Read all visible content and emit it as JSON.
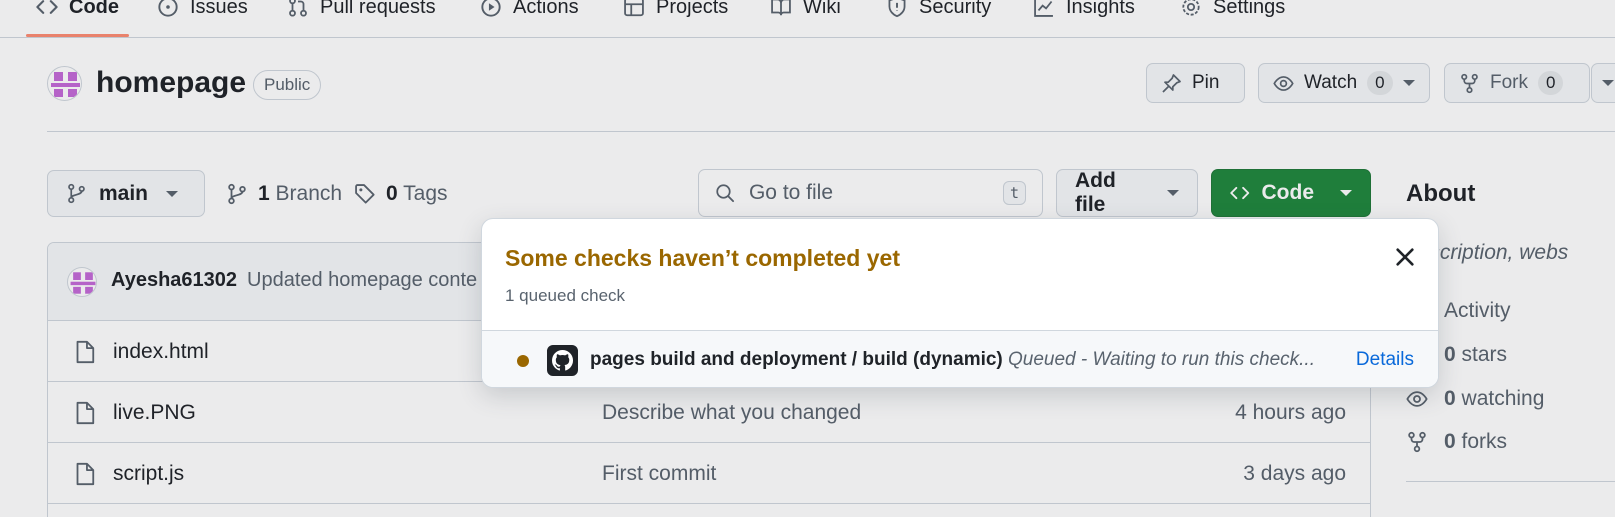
{
  "tabs": [
    {
      "label": "Code",
      "icon": "code-icon",
      "active": true
    },
    {
      "label": "Issues",
      "icon": "issue-opened-icon"
    },
    {
      "label": "Pull requests",
      "icon": "git-pull-request-icon"
    },
    {
      "label": "Actions",
      "icon": "play-icon"
    },
    {
      "label": "Projects",
      "icon": "table-icon"
    },
    {
      "label": "Wiki",
      "icon": "book-icon"
    },
    {
      "label": "Security",
      "icon": "shield-icon"
    },
    {
      "label": "Insights",
      "icon": "graph-icon"
    },
    {
      "label": "Settings",
      "icon": "gear-icon"
    }
  ],
  "repo": {
    "name": "homepage",
    "visibility": "Public",
    "pin_label": "Pin",
    "watch_label": "Watch",
    "watch_count": "0",
    "fork_label": "Fork",
    "fork_count": "0"
  },
  "branchbar": {
    "branch": "main",
    "branch_count": "1",
    "branch_label": "Branch",
    "tag_count": "0",
    "tag_label": "Tags",
    "search_placeholder": "Go to file",
    "search_shortcut": "t",
    "add_file_label": "Add file",
    "code_label": "Code"
  },
  "commit": {
    "author": "Ayesha61302",
    "message": "Updated homepage conte"
  },
  "files": [
    {
      "name": "index.html",
      "message": "",
      "time": ""
    },
    {
      "name": "live.PNG",
      "message": "Describe what you changed",
      "time": "4 hours ago"
    },
    {
      "name": "script.js",
      "message": "First commit",
      "time": "3 days ago"
    }
  ],
  "about": {
    "title": "About",
    "description": "description, webs",
    "activity_label": "Activity",
    "stars_count": "0",
    "stars_label": "stars",
    "watching_count": "0",
    "watching_label": "watching",
    "forks_count": "0",
    "forks_label": "forks"
  },
  "checks_popover": {
    "title": "Some checks haven’t completed yet",
    "subtitle": "1 queued check",
    "check_name": "pages build and deployment / build (dynamic)",
    "check_status": "Queued - Waiting to run this check...",
    "details_label": "Details"
  },
  "colors": {
    "accent_green": "#1f883d",
    "warning": "#9a6700",
    "link": "#0969da",
    "tab_underline": "#fd8c73"
  }
}
